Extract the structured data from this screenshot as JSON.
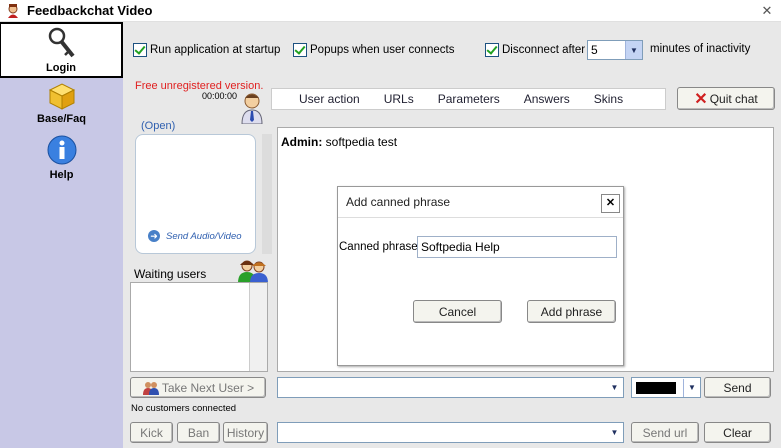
{
  "window": {
    "title": "Feedbackchat Video",
    "close_symbol": "✕"
  },
  "sidebar": {
    "items": [
      {
        "label": "Login",
        "icon": "key-icon"
      },
      {
        "label": "Base/Faq",
        "icon": "box-icon"
      },
      {
        "label": "Help",
        "icon": "info-icon"
      }
    ]
  },
  "options": {
    "run_at_startup": "Run application at startup",
    "popups_when_connects": "Popups when user connects",
    "disconnect_after": "Disconnect after",
    "disconnect_minutes": "5",
    "minutes_suffix": "minutes of inactivity"
  },
  "status": {
    "unregistered": "Free unregistered version.",
    "timer": "00:00:00",
    "open_label": "(Open)",
    "send_av": "Send Audio/Video",
    "waiting_users": "Waiting users",
    "no_customers": "No customers connected"
  },
  "tabs": [
    "User action",
    "URLs",
    "Parameters",
    "Answers",
    "Skins"
  ],
  "buttons": {
    "quit_chat": "Quit chat",
    "take_next_user": "Take Next User >",
    "send": "Send",
    "kick": "Kick",
    "ban": "Ban",
    "history": "History",
    "send_url": "Send url",
    "clear": "Clear"
  },
  "chat": {
    "sender": "Admin:",
    "message": "softpedia test"
  },
  "dialog": {
    "title": "Add canned phrase",
    "close_symbol": "✕",
    "field_label": "Canned phrase",
    "field_value": "Softpedia Help",
    "cancel": "Cancel",
    "add_phrase": "Add phrase"
  },
  "colors": {
    "sidebar_bg": "#c8c8e6",
    "unregistered_text": "#e02020",
    "link_blue": "#3060b0"
  }
}
